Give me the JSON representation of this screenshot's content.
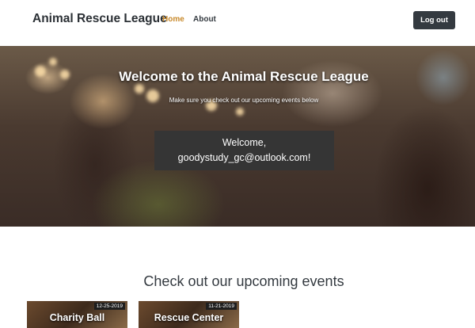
{
  "navbar": {
    "brand": "Animal Rescue League",
    "links": [
      {
        "label": "Home",
        "active": true
      },
      {
        "label": "About",
        "active": false
      }
    ],
    "logout_label": "Log out"
  },
  "hero": {
    "title": "Welcome to the Animal Rescue League",
    "subtitle": "Make sure you check out our upcoming events below",
    "welcome_line1": "Welcome,",
    "welcome_email": "goodystudy_gc@outlook.com!"
  },
  "events": {
    "heading": "Check out our upcoming events",
    "cards": [
      {
        "date": "12-25-2019",
        "title": "Charity Ball"
      },
      {
        "date": "11-21-2019",
        "title": "Rescue Center"
      }
    ]
  },
  "colors": {
    "active_link": "#c8892a",
    "dark_button": "#343a40",
    "welcome_box": "#353535"
  }
}
